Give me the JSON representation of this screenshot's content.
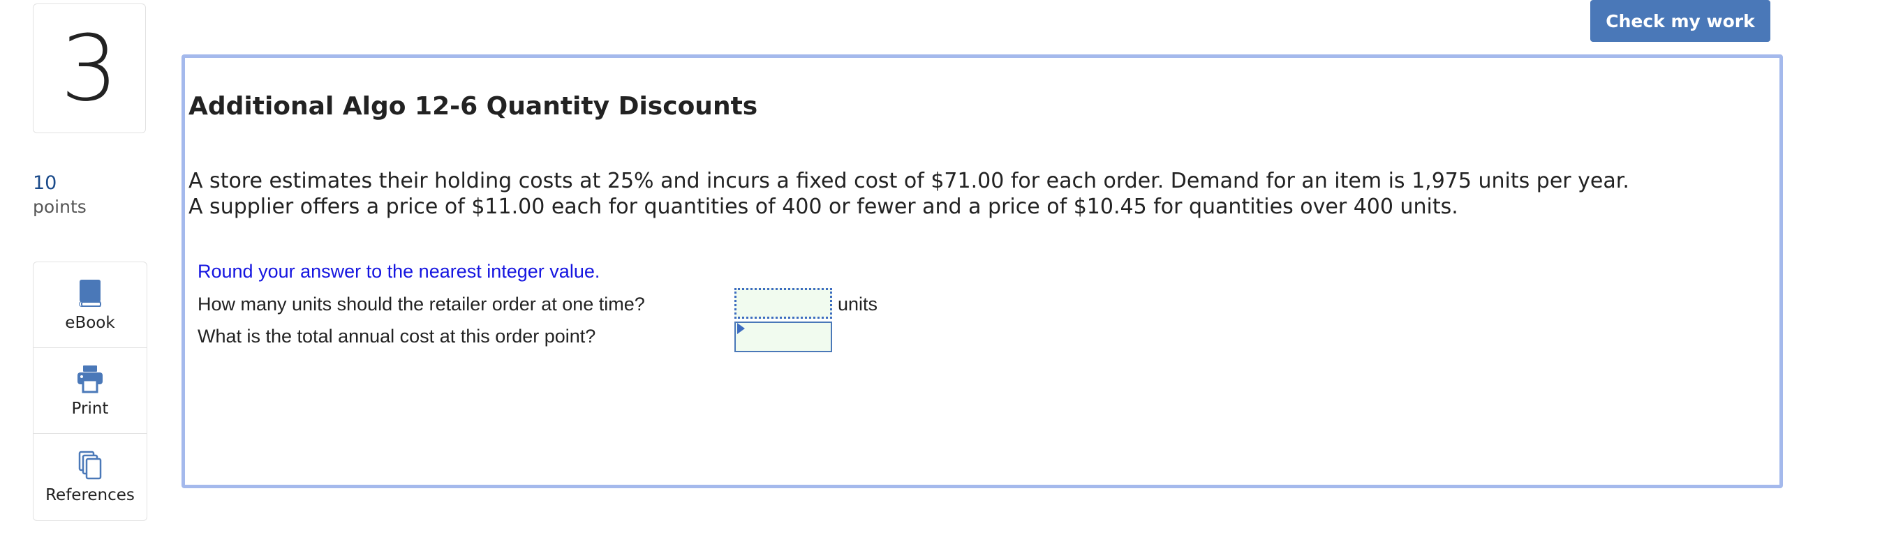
{
  "question": {
    "number": "3",
    "points_value": "10",
    "points_label": "points",
    "title": "Additional Algo 12-6 Quantity Discounts",
    "text_lines": [
      "A store estimates their holding costs at 25% and incurs a fixed cost of $71.00 for each order. Demand for an item is 1,975 units per year.",
      "A supplier offers a price of $11.00 each for quantities of 400 or fewer and a price of $10.45 for quantities over 400 units."
    ],
    "instruction": "Round your answer to the nearest integer value.",
    "rows": [
      {
        "label": "How many units should the retailer order at one time?",
        "value": "",
        "unit": "units"
      },
      {
        "label": "What is the total annual cost at this order point?",
        "value": "",
        "unit": ""
      }
    ]
  },
  "tools": [
    {
      "label": "eBook",
      "icon": "book-icon"
    },
    {
      "label": "Print",
      "icon": "printer-icon"
    },
    {
      "label": "References",
      "icon": "copy-icon"
    }
  ],
  "header": {
    "check_button_label": "Check my work"
  },
  "colors": {
    "accent": "#4a78b8",
    "frame_border": "#a4b9ec",
    "instruction_text": "#1515e0",
    "input_background": "#f1fbef"
  }
}
